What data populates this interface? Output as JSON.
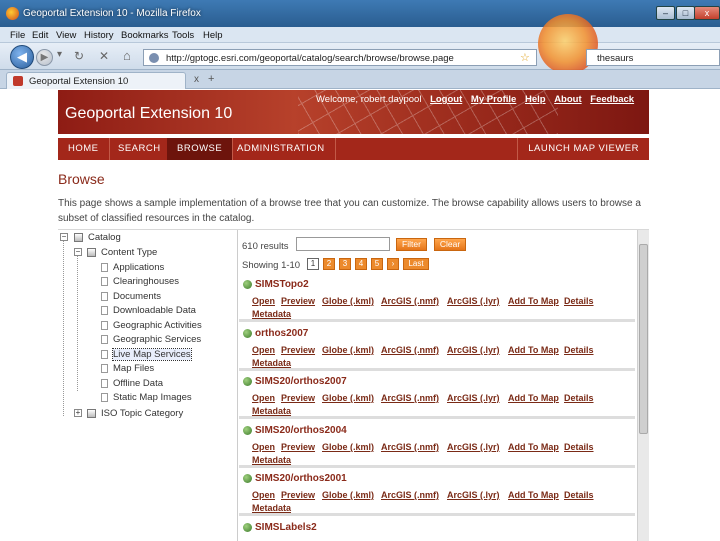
{
  "window": {
    "title": "Geoportal Extension 10 - Mozilla Firefox",
    "minimize": "–",
    "maximize": "□",
    "close": "x"
  },
  "menu": [
    "File",
    "Edit",
    "View",
    "History",
    "Bookmarks",
    "Tools",
    "Help"
  ],
  "nav": {
    "back": "◀",
    "forward": "▶",
    "dropdown": "▾",
    "reload": "↻",
    "stop": "✕",
    "home": "⌂",
    "url": "http://gptogc.esri.com/geoportal/catalog/search/browse/browse.page",
    "star": "☆",
    "search_value": "thesaurs"
  },
  "tabs": [
    {
      "label": "Geoportal Extension 10"
    }
  ],
  "tab_controls": {
    "close": "x",
    "new": "+"
  },
  "site": {
    "title": "Geoportal Extension 10",
    "welcome": "Welcome, robert.daypool",
    "links": [
      "Logout",
      "My Profile",
      "Help",
      "About",
      "Feedback"
    ],
    "nav": [
      "HOME",
      "SEARCH",
      "BROWSE",
      "ADMINISTRATION"
    ],
    "active_nav": "BROWSE",
    "launch": "LAUNCH MAP VIEWER"
  },
  "page": {
    "title": "Browse",
    "intro": "This page shows a sample implementation of a browse tree that you can customize. The browse capability allows users to browse a subset of classified resources in the catalog."
  },
  "tree": {
    "root": "Catalog",
    "group1": "Content Type",
    "items": [
      "Applications",
      "Clearinghouses",
      "Documents",
      "Downloadable Data",
      "Geographic Activities",
      "Geographic Services",
      "Live Map Services",
      "Map Files",
      "Offline Data",
      "Static Map Images"
    ],
    "selected": "Live Map Services",
    "group2": "ISO Topic Category",
    "expand_open": "−",
    "expand_closed": "+"
  },
  "results": {
    "count": "610 results",
    "filter_value": "",
    "filter_btn": "Filter",
    "clear_btn": "Clear",
    "showing": "Showing 1-10",
    "pages": [
      "1",
      "2",
      "3",
      "4",
      "5",
      "›",
      "Last"
    ],
    "current_page": "1",
    "records": [
      {
        "title": "SIMSTopo2",
        "links": [
          "Open",
          "Preview",
          "Globe (.kml)",
          "ArcGIS (.nmf)",
          "ArcGIS (.lyr)",
          "Add To Map",
          "Details"
        ],
        "meta": "Metadata"
      },
      {
        "title": "orthos2007",
        "links": [
          "Open",
          "Preview",
          "Globe (.kml)",
          "ArcGIS (.nmf)",
          "ArcGIS (.lyr)",
          "Add To Map",
          "Details"
        ],
        "meta": "Metadata"
      },
      {
        "title": "SIMS20/orthos2007",
        "links": [
          "Open",
          "Preview",
          "Globe (.kml)",
          "ArcGIS (.nmf)",
          "ArcGIS (.lyr)",
          "Add To Map",
          "Details"
        ],
        "meta": "Metadata"
      },
      {
        "title": "SIMS20/orthos2004",
        "links": [
          "Open",
          "Preview",
          "Globe (.kml)",
          "ArcGIS (.nmf)",
          "ArcGIS (.lyr)",
          "Add To Map",
          "Details"
        ],
        "meta": "Metadata"
      },
      {
        "title": "SIMS20/orthos2001",
        "links": [
          "Open",
          "Preview",
          "Globe (.kml)",
          "ArcGIS (.nmf)",
          "ArcGIS (.lyr)",
          "Add To Map",
          "Details"
        ],
        "meta": "Metadata"
      },
      {
        "title": "SIMSLabels2",
        "links": [],
        "meta": ""
      }
    ]
  }
}
